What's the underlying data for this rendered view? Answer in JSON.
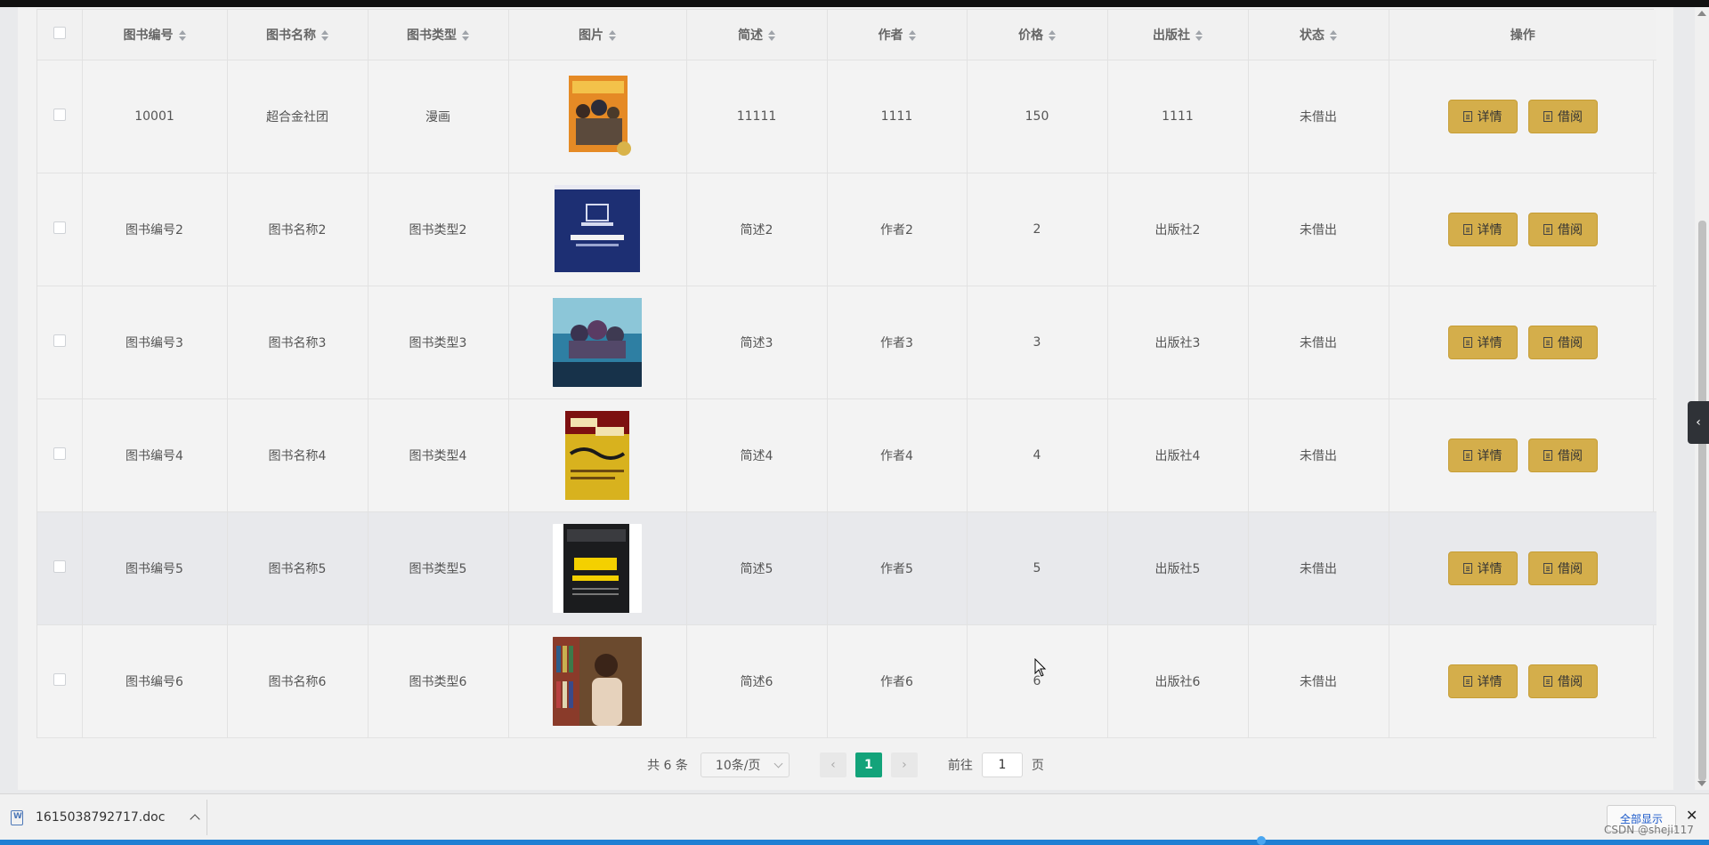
{
  "table": {
    "headers": [
      "图书编号",
      "图书名称",
      "图书类型",
      "图片",
      "简述",
      "作者",
      "价格",
      "出版社",
      "状态",
      "操作"
    ],
    "rows": [
      {
        "id": "10001",
        "name": "超合金社团",
        "type": "漫画",
        "desc": "11111",
        "author": "1111",
        "price": "150",
        "publisher": "1111",
        "status": "未借出",
        "image": "book-cover-comic"
      },
      {
        "id": "图书编号2",
        "name": "图书名称2",
        "type": "图书类型2",
        "desc": "简述2",
        "author": "作者2",
        "price": "2",
        "publisher": "出版社2",
        "status": "未借出",
        "image": "book-cover-robot"
      },
      {
        "id": "图书编号3",
        "name": "图书名称3",
        "type": "图书类型3",
        "desc": "简述3",
        "author": "作者3",
        "price": "3",
        "publisher": "出版社3",
        "status": "未借出",
        "image": "book-cover-fantasy"
      },
      {
        "id": "图书编号4",
        "name": "图书名称4",
        "type": "图书类型4",
        "desc": "简述4",
        "author": "作者4",
        "price": "4",
        "publisher": "出版社4",
        "status": "未借出",
        "image": "book-cover-health"
      },
      {
        "id": "图书编号5",
        "name": "图书名称5",
        "type": "图书类型5",
        "desc": "简述5",
        "author": "作者5",
        "price": "5",
        "publisher": "出版社5",
        "status": "未借出",
        "image": "book-cover-management"
      },
      {
        "id": "图书编号6",
        "name": "图书名称6",
        "type": "图书类型6",
        "desc": "简述6",
        "author": "作者6",
        "price": "6",
        "publisher": "出版社6",
        "status": "未借出",
        "image": "book-photo-library"
      }
    ],
    "actions": {
      "detail": "详情",
      "borrow": "借阅"
    }
  },
  "pagination": {
    "total": "共 6 条",
    "page_size": "10条/页",
    "prev": "‹",
    "current": "1",
    "next": "›",
    "goto_label": "前往",
    "goto_value": "1",
    "goto_suffix": "页"
  },
  "downloads": {
    "filename": "1615038792717.doc",
    "show_all": "全部显示",
    "close": "✕"
  },
  "watermark": "CSDN @sheji117",
  "side_toggle": "‹"
}
